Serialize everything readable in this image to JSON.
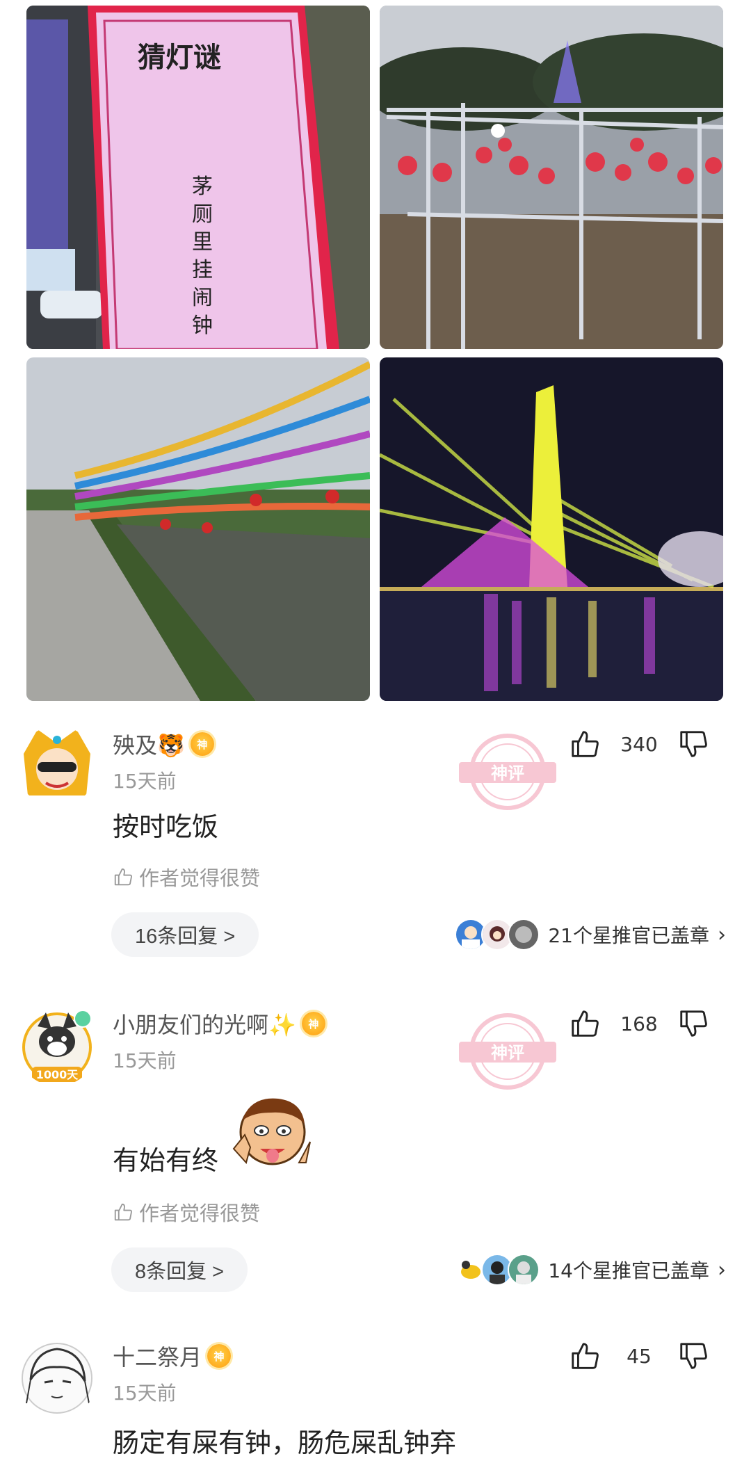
{
  "images": {
    "riddle_title": "猜灯谜",
    "riddle_text": [
      "茅",
      "厕",
      "里",
      "挂",
      "闹",
      "钟"
    ]
  },
  "comments": [
    {
      "username": "殃及🐯",
      "badge": "神",
      "time": "15天前",
      "content": "按时吃饭",
      "likes": "340",
      "author_liked": "作者觉得很赞",
      "replies": "16条回复 >",
      "stars_text": "21个星推官已盖章",
      "stamp_text": "神评"
    },
    {
      "username": "小朋友们的光啊✨",
      "badge": "神",
      "time": "15天前",
      "content": "有始有终",
      "likes": "168",
      "author_liked": "作者觉得很赞",
      "replies": "8条回复 >",
      "stars_text": "14个星推官已盖章",
      "stamp_text": "神评",
      "avatar_badge": "1000天"
    },
    {
      "username": "十二祭月",
      "badge": "神",
      "time": "15天前",
      "content": "肠定有屎有钟，肠危屎乱钟弃",
      "likes": "45"
    }
  ],
  "colors": {
    "accent_gold": "#ffad20",
    "stamp_pink": "#f19bb0",
    "pill_bg": "#f3f4f6"
  }
}
